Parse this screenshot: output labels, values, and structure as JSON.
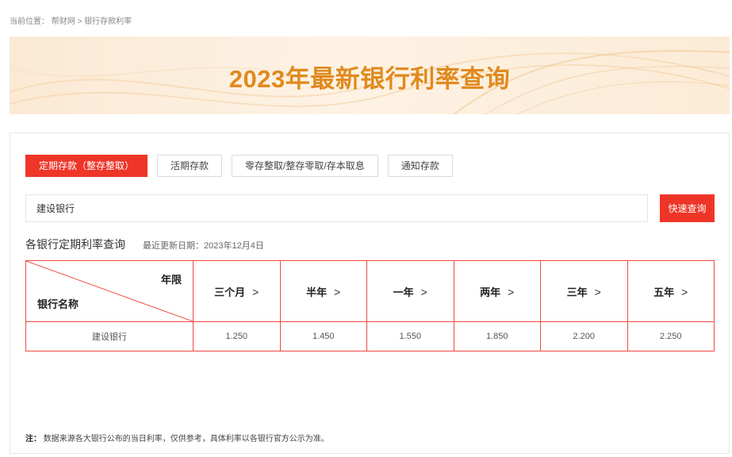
{
  "breadcrumb": {
    "prefix": "当前位置：",
    "site": "帮财网",
    "separator": ">",
    "current": "银行存款利率"
  },
  "banner": {
    "title": "2023年最新银行利率查询"
  },
  "tabs": [
    {
      "label": "定期存款（整存整取）",
      "active": true
    },
    {
      "label": "活期存款",
      "active": false
    },
    {
      "label": "零存整取/整存零取/存本取息",
      "active": false
    },
    {
      "label": "通知存款",
      "active": false
    }
  ],
  "search": {
    "value": "建设银行",
    "button": "快速查询"
  },
  "section": {
    "title": "各银行定期利率查询",
    "updated": "最近更新日期：2023年12月4日"
  },
  "table": {
    "corner_top": "年限",
    "corner_bottom": "银行名称",
    "chevron": ">",
    "columns": [
      "三个月",
      "半年",
      "一年",
      "两年",
      "三年",
      "五年"
    ],
    "rows": [
      {
        "bank": "建设银行",
        "rates": [
          "1.250",
          "1.450",
          "1.550",
          "1.850",
          "2.200",
          "2.250"
        ]
      }
    ]
  },
  "note": {
    "label": "注：",
    "text": "数据来源各大银行公布的当日利率，仅供参考，具体利率以各银行官方公示为准。"
  },
  "colors": {
    "accent": "#ee3528",
    "banner_title": "#e08a1e",
    "table_border": "#ee4a3e"
  }
}
